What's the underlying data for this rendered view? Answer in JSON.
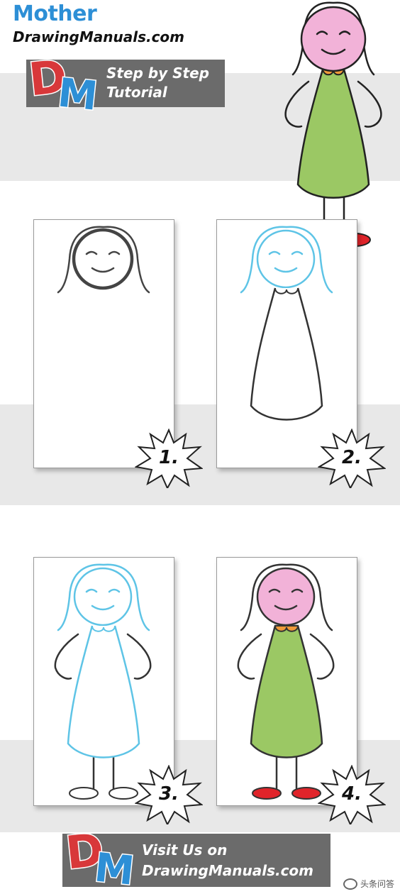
{
  "header": {
    "title": "Mother",
    "site": "DrawingManuals.com",
    "logo_letters": "DM",
    "banner_line1": "Step by Step",
    "banner_line2": "Tutorial"
  },
  "steps": [
    {
      "number": "1."
    },
    {
      "number": "2."
    },
    {
      "number": "3."
    },
    {
      "number": "4."
    }
  ],
  "footer": {
    "logo_letters": "DM",
    "line1": "Visit Us on",
    "line2": "DrawingManuals.com"
  },
  "watermark": "头条问答",
  "colors": {
    "title_blue": "#2d8fd6",
    "step_blue": "#5ec4e6",
    "skin_pink": "#f2b2d8",
    "dress_green": "#9bc864",
    "collar_orange": "#f09a3a",
    "shoe_red": "#e0242a",
    "banner_gray": "#6b6b6b",
    "band_gray": "#e8e8e8"
  }
}
